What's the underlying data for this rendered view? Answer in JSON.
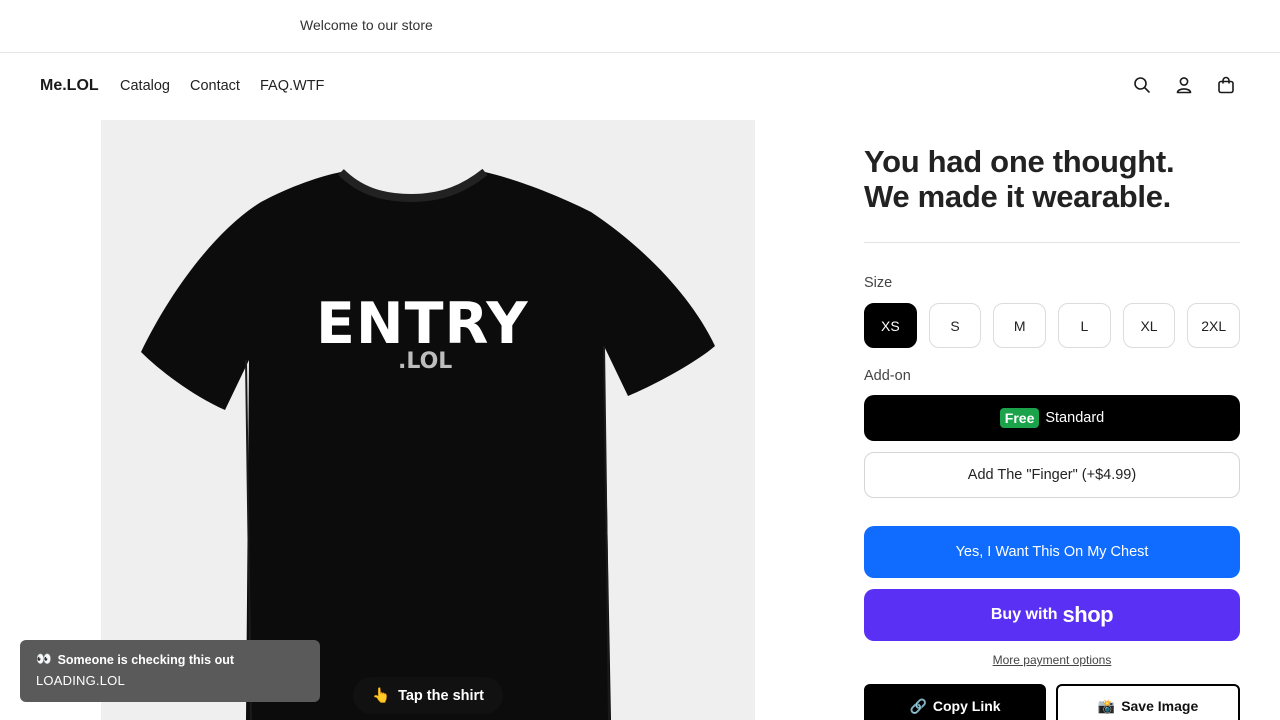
{
  "announcement": {
    "text": "Welcome to our store"
  },
  "header": {
    "logo": "Me.LOL",
    "nav": [
      "Catalog",
      "Contact",
      "FAQ.WTF"
    ],
    "icons": [
      "search-icon",
      "account-icon",
      "cart-icon"
    ]
  },
  "product_image": {
    "print_main": "ENTRY",
    "print_sub": ".LOL",
    "tap_label": "Tap the shirt",
    "tap_emoji": "👆"
  },
  "toast": {
    "emoji": "👀",
    "line1": "Someone is checking this out",
    "line2": "LOADING.LOL"
  },
  "product": {
    "title_line1": "You had one thought.",
    "title_line2": "We made it wearable.",
    "size_label": "Size",
    "sizes": [
      "XS",
      "S",
      "M",
      "L",
      "XL",
      "2XL"
    ],
    "selected_size": "XS",
    "addon_label": "Add-on",
    "addon_standard_badge": "Free",
    "addon_standard_label": "Standard",
    "addon_finger_label": "Add The \"Finger\" (+$4.99)",
    "cta_label": "Yes, I Want This On My Chest",
    "shop_prefix": "Buy with",
    "shop_logo": "shop",
    "more_payment": "More payment options",
    "copy_link_label": "Copy Link",
    "copy_link_emoji": "🔗",
    "save_image_label": "Save Image",
    "save_image_emoji": "📸"
  },
  "colors": {
    "primary_blue": "#0f6cff",
    "shop_purple": "#5a31f4",
    "free_green": "#1aa34a",
    "black": "#000000"
  }
}
